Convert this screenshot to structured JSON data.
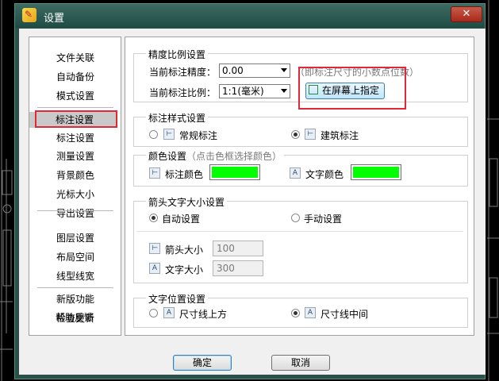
{
  "window": {
    "title": "设置",
    "close_glyph": "✕"
  },
  "nav": {
    "items": [
      {
        "label": "文件关联"
      },
      {
        "label": "自动备份"
      },
      {
        "label": "模式设置"
      },
      {
        "label": "标注设置"
      },
      {
        "label": "测量设置"
      },
      {
        "label": "背景颜色"
      },
      {
        "label": "光标大小"
      },
      {
        "label": "导出设置"
      },
      {
        "label": "图层设置"
      },
      {
        "label": "布局空间"
      },
      {
        "label": "线型线宽"
      },
      {
        "label": "新版功能"
      },
      {
        "label": "检查更新"
      },
      {
        "label": "帮助反馈"
      }
    ],
    "selected": "标注设置"
  },
  "precision": {
    "title": "精度比例设置",
    "precision_label": "当前标注精度：",
    "precision_value": "0.00",
    "precision_hint": "（即标注尺寸的小数点位数）",
    "scale_label": "当前标注比例：",
    "scale_value": "1:1(毫米)",
    "pick_button": "在屏幕上指定"
  },
  "style": {
    "title": "标注样式设置",
    "option_normal": "常规标注",
    "option_arch": "建筑标注",
    "selected": "建筑标注"
  },
  "color": {
    "title": "颜色设置",
    "hint": "（点击色框选择颜色）",
    "dim_color_label": "标注颜色",
    "dim_color": "#00ff00",
    "text_color_label": "文字颜色",
    "text_color": "#00ff00"
  },
  "arrow": {
    "title": "箭头文字大小设置",
    "option_auto": "自动设置",
    "option_manual": "手动设置",
    "selected": "自动设置",
    "arrow_size_label": "箭头大小",
    "arrow_size_value": "100",
    "text_size_label": "文字大小",
    "text_size_value": "300"
  },
  "text_pos": {
    "title": "文字位置设置",
    "option_above": "尺寸线上方",
    "option_middle": "尺寸线中间",
    "selected": "尺寸线中间"
  },
  "footer": {
    "ok": "确定",
    "cancel": "取消"
  },
  "colors": {
    "highlight": "#e0283a",
    "titlebar": "#2b4f49",
    "swatch_green": "#00ff00"
  }
}
